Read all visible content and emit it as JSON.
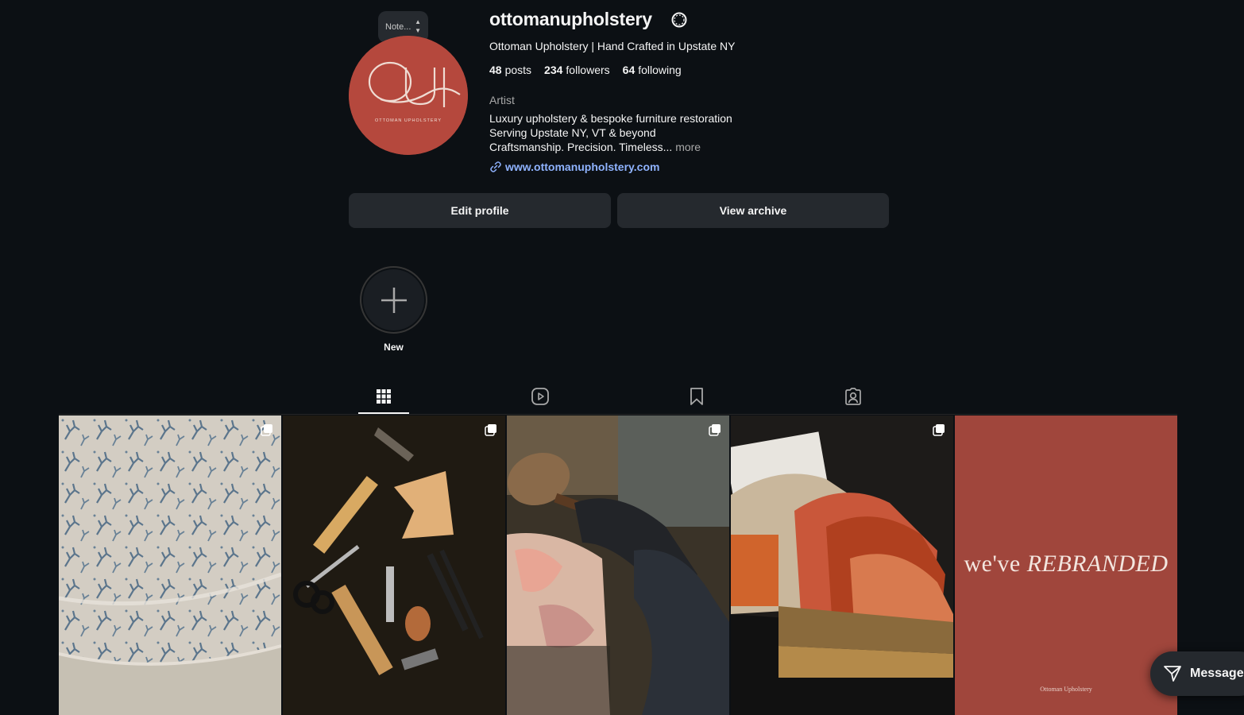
{
  "profile": {
    "note_placeholder": "Note...",
    "username": "ottomanupholstery",
    "full_name": "Ottoman Upholstery | Hand Crafted in Upstate NY",
    "stats": {
      "posts_count": "48",
      "posts_label": "posts",
      "followers_count": "234",
      "followers_label": "followers",
      "following_count": "64",
      "following_label": "following"
    },
    "category": "Artist",
    "bio_lines": [
      "Luxury upholstery & bespoke furniture restoration",
      "Serving Upstate NY, VT & beyond",
      "Craftsmanship. Precision. Timeless..."
    ],
    "bio_more": "more",
    "website": "www.ottomanupholstery.com",
    "avatar_bg": "#b5483d",
    "avatar_logo": "OU monogram",
    "avatar_wordmark": "OTTOMAN UPHOLSTERY"
  },
  "actions": {
    "edit_profile": "Edit profile",
    "view_archive": "View archive"
  },
  "highlights": {
    "new_label": "New"
  },
  "tabs": [
    {
      "name": "posts",
      "icon": "grid-icon",
      "active": true
    },
    {
      "name": "reels",
      "icon": "reels-icon",
      "active": false
    },
    {
      "name": "saved",
      "icon": "bookmark-icon",
      "active": false
    },
    {
      "name": "tagged",
      "icon": "tagged-icon",
      "active": false
    }
  ],
  "posts": [
    {
      "subject": "blue coral print upholstered cushion",
      "multi": true
    },
    {
      "subject": "upholstery tools on dark background",
      "multi": true
    },
    {
      "subject": "craftsman with mallet and gloves",
      "multi": true
    },
    {
      "subject": "fabric swatch books",
      "multi": true
    },
    {
      "headline_plain": "we've",
      "headline_italic": "REBRANDED",
      "footer": "Ottoman Upholstery",
      "multi": false
    }
  ],
  "messages": {
    "label": "Messages"
  },
  "colors": {
    "background": "#0c1014",
    "button_bg": "#25292e",
    "link": "#8fb3ff",
    "brand_red": "#a0463c"
  }
}
